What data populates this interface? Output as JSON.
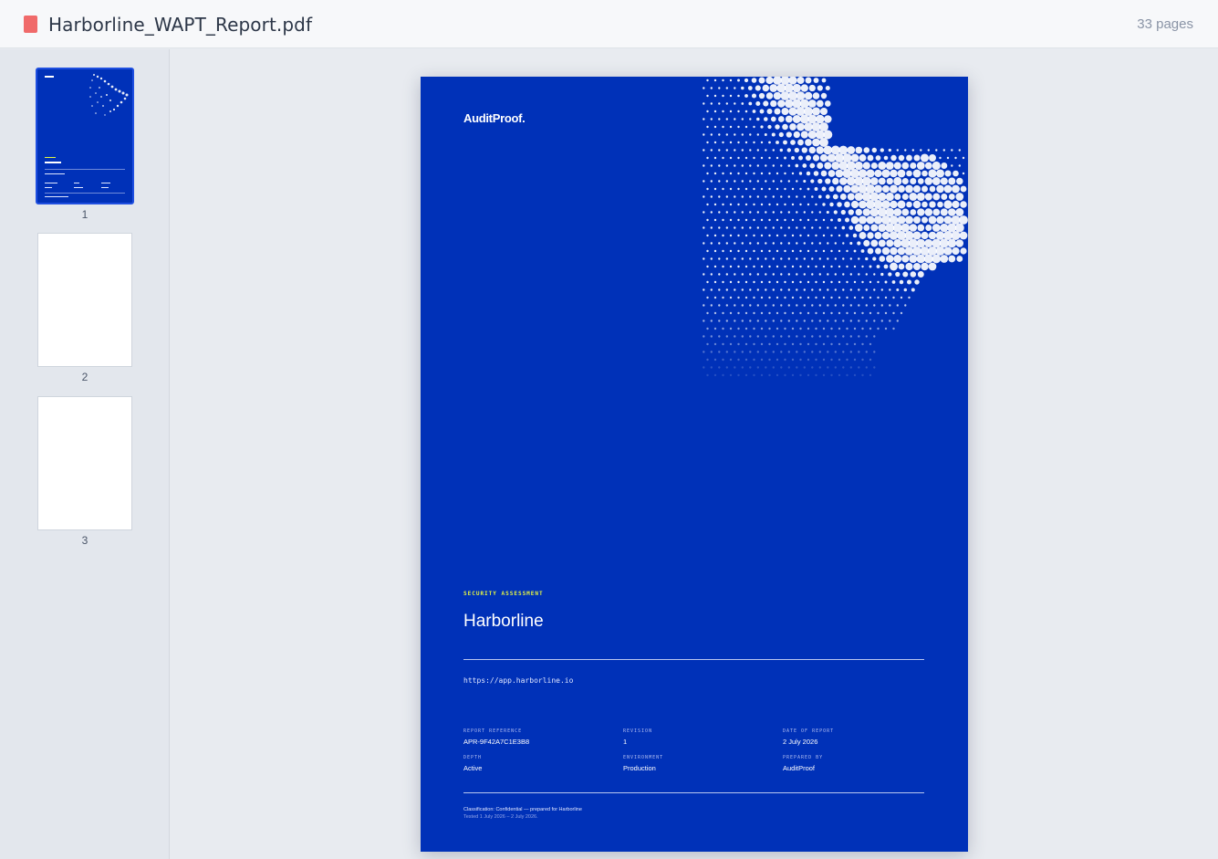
{
  "header": {
    "file_name": "Harborline_WAPT_Report.pdf",
    "page_count": "33 pages",
    "file_icon": "pdf-file-icon",
    "file_icon_color": "#f06a6a"
  },
  "sidebar": {
    "thumbnails": [
      {
        "number": "1",
        "active": true
      },
      {
        "number": "2",
        "active": false
      },
      {
        "number": "3",
        "active": false
      }
    ]
  },
  "cover": {
    "background_color": "#0031b8",
    "accent_color": "#e4f542",
    "logo": "AuditProof.",
    "eyebrow": "SECURITY ASSESSMENT",
    "client": "Harborline",
    "url": "https://app.harborline.io",
    "meta": [
      {
        "label": "REPORT REFERENCE",
        "value": "APR-9F42A7C1E3B8"
      },
      {
        "label": "REVISION",
        "value": "1"
      },
      {
        "label": "DATE OF REPORT",
        "value": "2 July 2026"
      },
      {
        "label": "DEPTH",
        "value": "Active"
      },
      {
        "label": "ENVIRONMENT",
        "value": "Production"
      },
      {
        "label": "PREPARED BY",
        "value": "AuditProof"
      }
    ],
    "classification": "Classification: Confidential — prepared for Harborline",
    "tested": "Tested 1 July 2026 – 2 July 2026."
  }
}
